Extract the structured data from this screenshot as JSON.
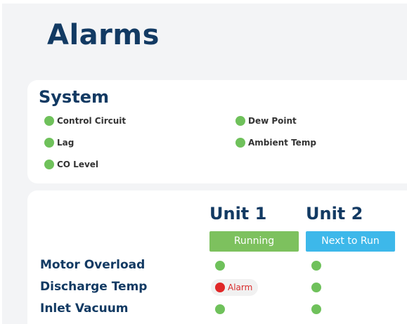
{
  "page": {
    "title": "Alarms"
  },
  "system": {
    "title": "System",
    "items": [
      {
        "label": "Control Circuit",
        "status": "ok"
      },
      {
        "label": "Dew Point",
        "status": "ok"
      },
      {
        "label": "Lag",
        "status": "ok"
      },
      {
        "label": "Ambient Temp",
        "status": "ok"
      },
      {
        "label": "CO Level",
        "status": "ok"
      }
    ]
  },
  "units": [
    {
      "name": "Unit 1",
      "state": "Running",
      "state_color": "#7dc15e"
    },
    {
      "name": "Unit 2",
      "state": "Next to Run",
      "state_color": "#3db8ea"
    }
  ],
  "alarm_rows": [
    {
      "label": "Motor Overload",
      "unit1": "ok",
      "unit2": "ok"
    },
    {
      "label": "Discharge Temp",
      "unit1": "alarm",
      "unit1_text": "Alarm",
      "unit2": "ok"
    },
    {
      "label": "Inlet Vacuum",
      "unit1": "ok",
      "unit2": "ok"
    }
  ],
  "colors": {
    "ok": "#6fc15b",
    "alarm": "#e02828",
    "heading": "#123a63"
  }
}
